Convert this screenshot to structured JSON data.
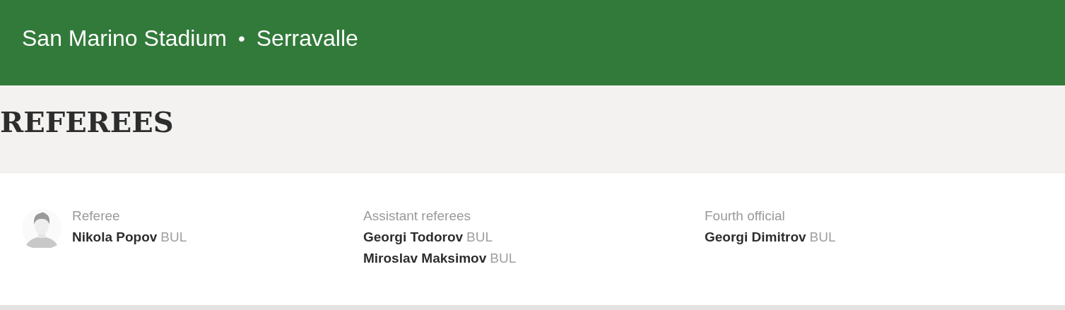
{
  "header": {
    "stadium": "San Marino Stadium",
    "separator": "•",
    "city": "Serravalle"
  },
  "heading": "REFEREES",
  "officials": [
    {
      "role": "Referee",
      "avatar": true,
      "people": [
        {
          "name": "Nikola Popov",
          "country": "BUL"
        }
      ]
    },
    {
      "role": "Assistant referees",
      "avatar": false,
      "people": [
        {
          "name": "Georgi Todorov",
          "country": "BUL"
        },
        {
          "name": "Miroslav Maksimov",
          "country": "BUL"
        }
      ]
    },
    {
      "role": "Fourth official",
      "avatar": false,
      "people": [
        {
          "name": "Georgi Dimitrov",
          "country": "BUL"
        }
      ]
    }
  ]
}
